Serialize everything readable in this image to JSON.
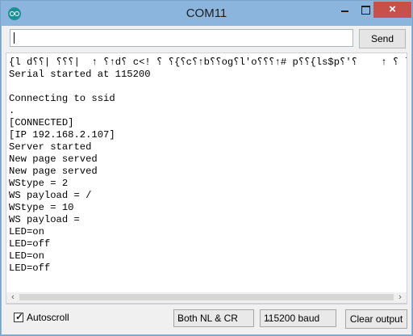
{
  "window": {
    "title": "COM11",
    "icon": "arduino-icon"
  },
  "input": {
    "value": "",
    "placeholder": ""
  },
  "buttons": {
    "send": "Send",
    "clear": "Clear output"
  },
  "console": {
    "lines": [
      "{l d⸮⸮| ⸮⸮⸮|  ↑ ⸮↑d⸮ c<! ⸮ ⸮{⸮c⸮↑b⸮⸮og⸮l'o⸮⸮⸮↑# p⸮⸮{ls$p⸮'⸮    ↑ ⸮ l ⸮⸮ ↑ c o⸮<",
      "Serial started at 115200",
      "",
      "Connecting to ssid",
      ".",
      "[CONNECTED]",
      "[IP 192.168.2.107]",
      "Server started",
      "New page served",
      "New page served",
      "WStype = 2",
      "WS payload = /",
      "WStype = 10",
      "WS payload =",
      "LED=on",
      "LED=off",
      "LED=on",
      "LED=off"
    ]
  },
  "footer": {
    "autoscroll_label": "Autoscroll",
    "autoscroll_checked": true,
    "line_ending": "Both NL & CR",
    "baud": "115200 baud"
  }
}
